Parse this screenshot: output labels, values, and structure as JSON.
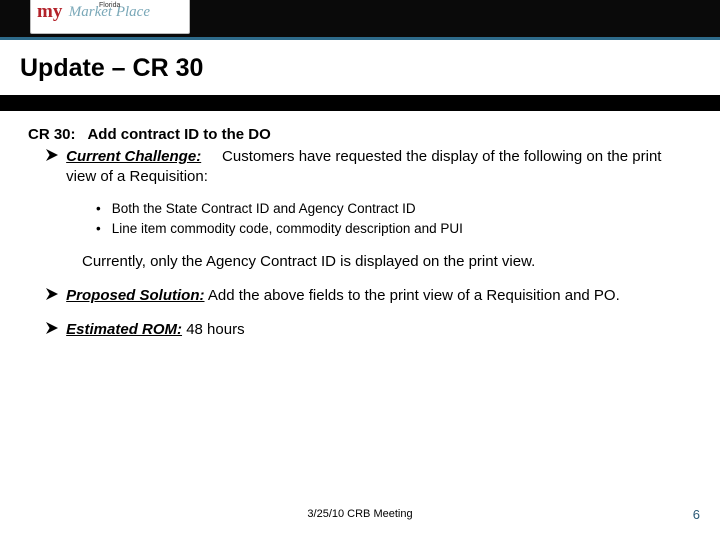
{
  "header": {
    "logo": {
      "left": "my",
      "right": "Market Place",
      "tag": "Florida"
    }
  },
  "title": "Update – CR 30",
  "cr": {
    "id": "CR 30:",
    "desc": "Add contract ID to the DO"
  },
  "items": {
    "challenge": {
      "label": "Current Challenge:",
      "text": "Customers have requested the display of the following on the print view of a Requisition:",
      "bullets": [
        "Both the State Contract ID and Agency Contract ID",
        "Line item commodity code, commodity description and PUI"
      ],
      "currently": "Currently, only the Agency Contract ID is displayed on the print view."
    },
    "solution": {
      "label": "Proposed Solution:",
      "text": "Add the above fields to the print view of a Requisition and PO."
    },
    "rom": {
      "label": "Estimated ROM:",
      "text": "48 hours"
    }
  },
  "footer": {
    "date": "3/25/10 CRB Meeting",
    "page": "6"
  }
}
